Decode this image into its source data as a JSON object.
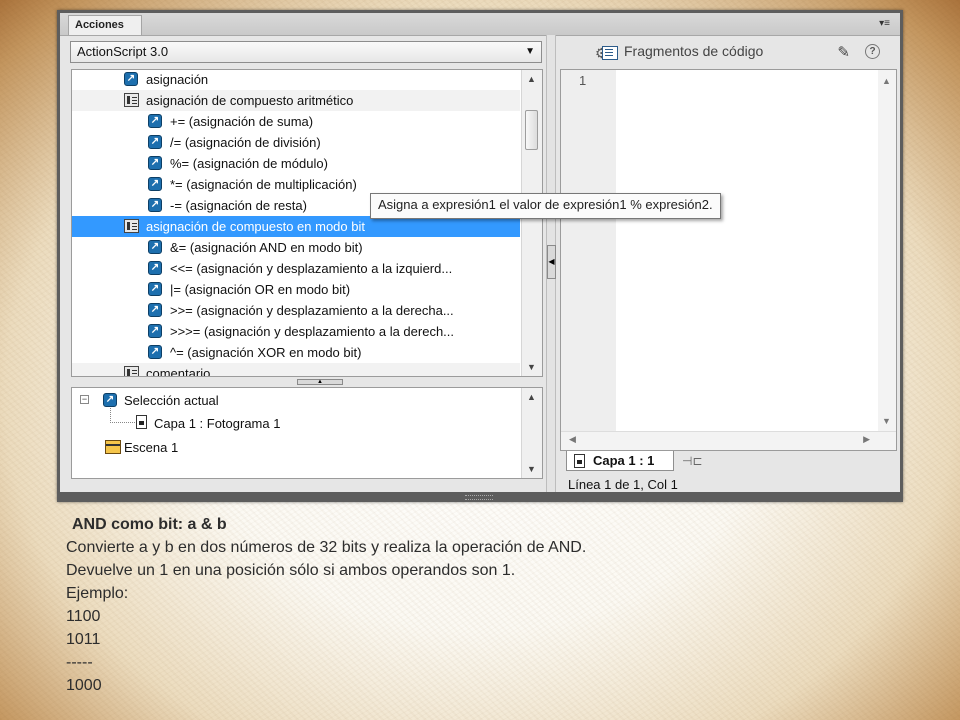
{
  "panel": {
    "tab_label": "Acciones",
    "menu_glyph": "▾≡",
    "language_value": "ActionScript 3.0",
    "snippets_label": "Fragmentos de código"
  },
  "tree": {
    "items": [
      {
        "label": "asignación",
        "kind": "op",
        "indent": 0
      },
      {
        "label": "asignación de compuesto aritmético",
        "kind": "category",
        "indent": 0
      },
      {
        "label": "+= (asignación de suma)",
        "kind": "op",
        "indent": 1
      },
      {
        "label": "/= (asignación de división)",
        "kind": "op",
        "indent": 1
      },
      {
        "label": "%= (asignación de módulo)",
        "kind": "op",
        "indent": 1
      },
      {
        "label": "*= (asignación de multiplicación)",
        "kind": "op",
        "indent": 1
      },
      {
        "label": "-= (asignación de resta)",
        "kind": "op",
        "indent": 1
      },
      {
        "label": "asignación de compuesto en modo bit",
        "kind": "category",
        "indent": 0,
        "selected": true
      },
      {
        "label": "&= (asignación AND en modo bit)",
        "kind": "op",
        "indent": 1
      },
      {
        "label": "<<= (asignación y desplazamiento a la izquierd...",
        "kind": "op",
        "indent": 1
      },
      {
        "label": "|= (asignación OR en modo bit)",
        "kind": "op",
        "indent": 1
      },
      {
        "label": ">>= (asignación y desplazamiento a la derecha...",
        "kind": "op",
        "indent": 1
      },
      {
        "label": ">>>= (asignación y desplazamiento a la derech...",
        "kind": "op",
        "indent": 1
      },
      {
        "label": "^= (asignación XOR en modo bit)",
        "kind": "op",
        "indent": 1
      },
      {
        "label": "comentario",
        "kind": "category",
        "indent": 0
      }
    ]
  },
  "tooltip": "Asigna a expresión1 el valor de expresión1 % expresión2.",
  "scope": {
    "current_selection": "Selección actual",
    "frame": "Capa 1 : Fotograma 1",
    "scene": "Escena 1"
  },
  "editor": {
    "line_number": "1",
    "script_tab": "Capa 1 : 1",
    "status": "Línea 1 de 1, Col 1"
  },
  "slide": {
    "heading": "AND como bit: a & b",
    "lines": [
      "Convierte  a y b en dos números de 32 bits y realiza la operación  de  AND.",
      "Devuelve un 1 en una posición sólo si ambos operandos  son 1.",
      "Ejemplo:",
      "1100",
      "1011",
      "-----",
      "1000"
    ]
  },
  "colors": {
    "selection": "#3399ff",
    "icon_blue": "#1d6fae",
    "frame_brown": "#aa733c"
  }
}
